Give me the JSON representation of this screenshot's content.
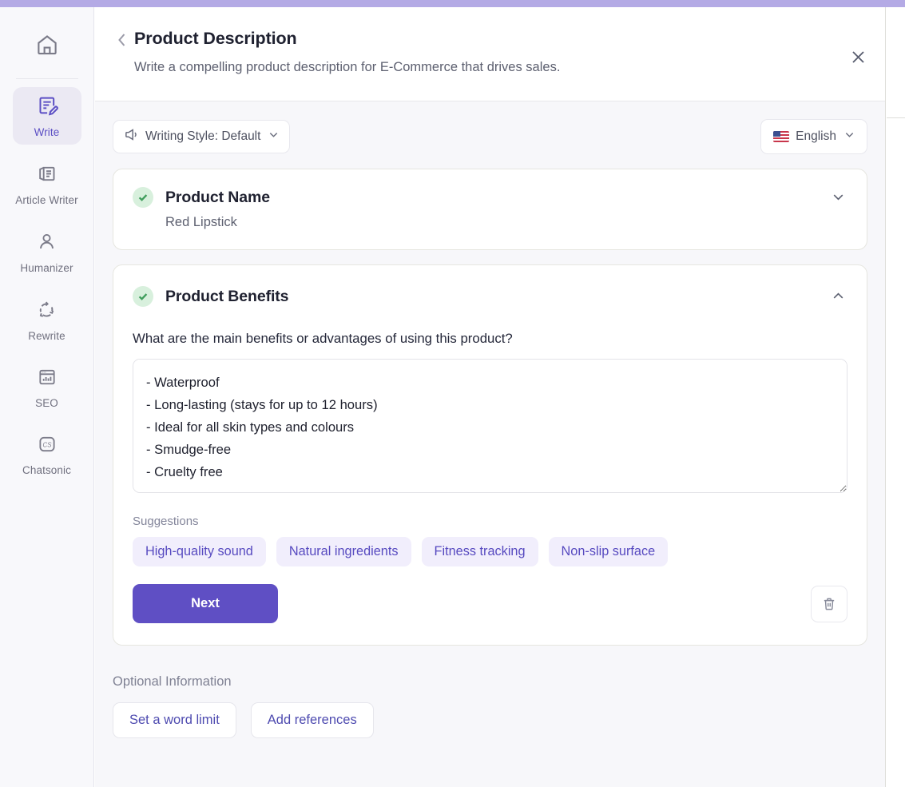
{
  "sidebar": {
    "items": [
      {
        "id": "home",
        "label": "",
        "icon": "home-icon",
        "active": false
      },
      {
        "id": "write",
        "label": "Write",
        "icon": "write-icon",
        "active": true
      },
      {
        "id": "article-writer",
        "label": "Article Writer",
        "icon": "article-icon",
        "active": false
      },
      {
        "id": "humanizer",
        "label": "Humanizer",
        "icon": "person-icon",
        "active": false
      },
      {
        "id": "rewrite",
        "label": "Rewrite",
        "icon": "refresh-icon",
        "active": false
      },
      {
        "id": "seo",
        "label": "SEO",
        "icon": "analytics-icon",
        "active": false
      },
      {
        "id": "chatsonic",
        "label": "Chatsonic",
        "icon": "cs-icon",
        "active": false
      }
    ]
  },
  "header": {
    "back_icon": "chevron-left-icon",
    "title": "Product Description",
    "subtitle": "Write a compelling product description for E-Commerce that drives sales.",
    "close_icon": "close-icon"
  },
  "toolbar": {
    "writing_style": {
      "icon": "megaphone-icon",
      "label": "Writing Style: Default",
      "chevron": "chevron-down-icon"
    },
    "language": {
      "flag": "us-flag-icon",
      "label": "English",
      "chevron": "chevron-down-icon"
    }
  },
  "cards": [
    {
      "id": "product-name",
      "status_icon": "check-circle-icon",
      "title": "Product Name",
      "value": "Red Lipstick",
      "chevron": "chevron-down-icon",
      "expanded": false
    },
    {
      "id": "product-benefits",
      "status_icon": "check-circle-icon",
      "title": "Product Benefits",
      "chevron": "chevron-up-icon",
      "expanded": true,
      "question": "What are the main benefits or advantages of using this product?",
      "textarea_value": "- Waterproof\n- Long-lasting (stays for up to 12 hours)\n- Ideal for all skin types and colours\n- Smudge-free\n- Cruelty free",
      "textarea_placeholder": "",
      "suggestions_label": "Suggestions",
      "suggestions": [
        "High-quality sound",
        "Natural ingredients",
        "Fitness tracking",
        "Non-slip surface"
      ],
      "next_label": "Next",
      "delete_icon": "trash-icon"
    }
  ],
  "optional": {
    "label": "Optional Information",
    "buttons": [
      "Set a word limit",
      "Add references"
    ]
  },
  "colors": {
    "accent": "#5f4fc4",
    "accent_light": "#f1eefc",
    "top_bar": "#b4aae5",
    "success": "#3f9d5c",
    "success_bg": "#d8f0dd",
    "panel_bg": "#f7f7fa",
    "sidebar_bg": "#f8f8fb"
  }
}
